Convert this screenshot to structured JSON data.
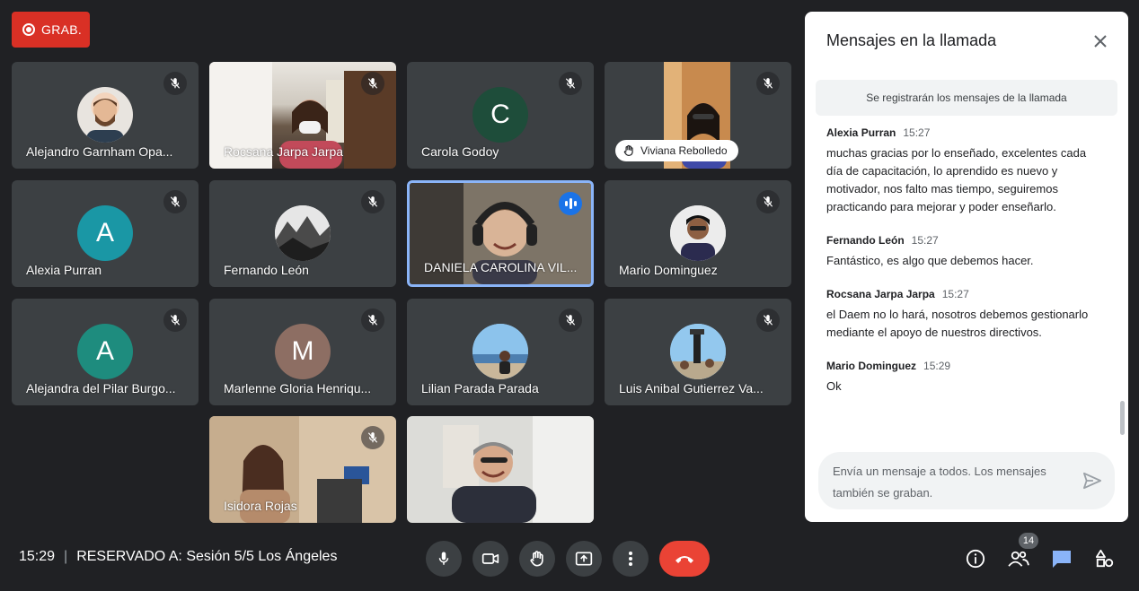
{
  "recording": {
    "label": "GRAB."
  },
  "tiles": [
    {
      "name": "Alejandro Garnham Opa...",
      "type": "avatar-photo"
    },
    {
      "name": "Rocsana Jarpa Jarpa",
      "type": "video"
    },
    {
      "name": "Carola Godoy",
      "type": "letter",
      "letter": "C",
      "color": "#1e4d3a"
    },
    {
      "name": "Viviana Rebolledo",
      "type": "video-pill"
    },
    {
      "name": "Alexia Purran",
      "type": "letter",
      "letter": "A",
      "color": "#1a97a5"
    },
    {
      "name": "Fernando León",
      "type": "avatar-photo"
    },
    {
      "name": "DANIELA CAROLINA VIL...",
      "type": "video-active"
    },
    {
      "name": "Mario Dominguez",
      "type": "avatar-photo"
    },
    {
      "name": "Alejandra del Pilar Burgo...",
      "type": "letter",
      "letter": "A",
      "color": "#1e8c7e"
    },
    {
      "name": "Marlenne Gloria Henriqu...",
      "type": "letter",
      "letter": "M",
      "color": "#8d6e63"
    },
    {
      "name": "Lilian Parada Parada",
      "type": "avatar-photo"
    },
    {
      "name": "Luis Anibal Gutierrez Va...",
      "type": "avatar-photo"
    },
    {
      "name": "Isidora Rojas",
      "type": "video"
    },
    {
      "name": "",
      "type": "video"
    }
  ],
  "chat": {
    "title": "Mensajes en la llamada",
    "notice": "Se registrarán los mensajes de la llamada",
    "messages": [
      {
        "sender": "Alexia Purran",
        "time": "15:27",
        "text": "muchas gracias por lo enseñado, excelentes cada día de capacitación, lo aprendido es nuevo y motivador, nos falto mas tiempo, seguiremos practicando para mejorar y poder enseñarlo."
      },
      {
        "sender": "Fernando León",
        "time": "15:27",
        "text": "Fantástico, es algo que debemos hacer."
      },
      {
        "sender": "Rocsana Jarpa Jarpa",
        "time": "15:27",
        "text": "el Daem no lo hará, nosotros debemos gestionarlo mediante el apoyo de nuestros directivos."
      },
      {
        "sender": "Mario Dominguez",
        "time": "15:29",
        "text": "Ok"
      }
    ],
    "input_placeholder": "Envía un mensaje a todos. Los mensajes también se graban."
  },
  "meeting": {
    "time": "15:29",
    "separator": "|",
    "title": "RESERVADO A: Sesión 5/5 Los Ángeles"
  },
  "participants_count": "14",
  "colors": {
    "accent": "#1a73e8",
    "record": "#d93025",
    "hangup": "#ea4335",
    "chat_active": "#8ab4f8"
  }
}
